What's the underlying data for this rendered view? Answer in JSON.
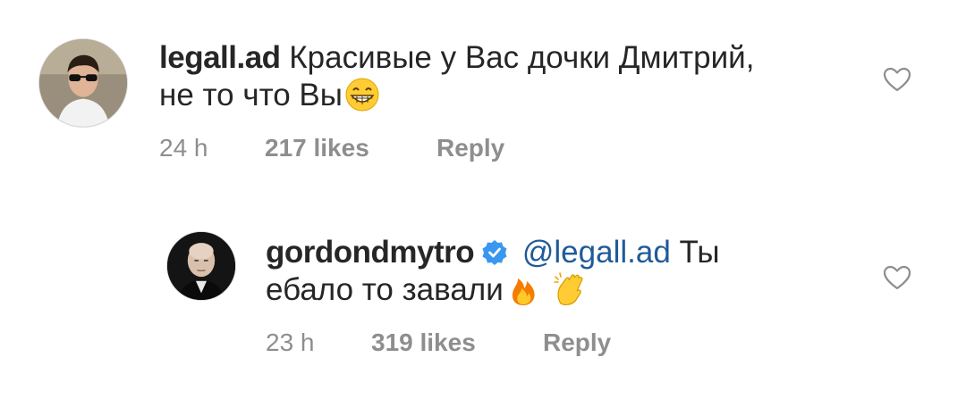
{
  "comments": [
    {
      "username": "legall.ad",
      "text_line1": "Красивые у Вас дочки Дмитрий,",
      "text_line2": "не то что Вы",
      "emojis": [
        "grinning-face-with-smiling-eyes"
      ],
      "time": "24 h",
      "likes": "217 likes",
      "reply_label": "Reply"
    },
    {
      "username": "gordondmytro",
      "verified": true,
      "mention": "@legall.ad",
      "text_line1_after_mention": "Ты",
      "text_line2": "ебало то завали",
      "emojis": [
        "fire",
        "clapping-hands"
      ],
      "time": "23 h",
      "likes": "319 likes",
      "reply_label": "Reply"
    }
  ],
  "colors": {
    "text": "#262626",
    "meta": "#8e8e8e",
    "mention": "#1f5a99",
    "verified_badge": "#3897f0"
  }
}
